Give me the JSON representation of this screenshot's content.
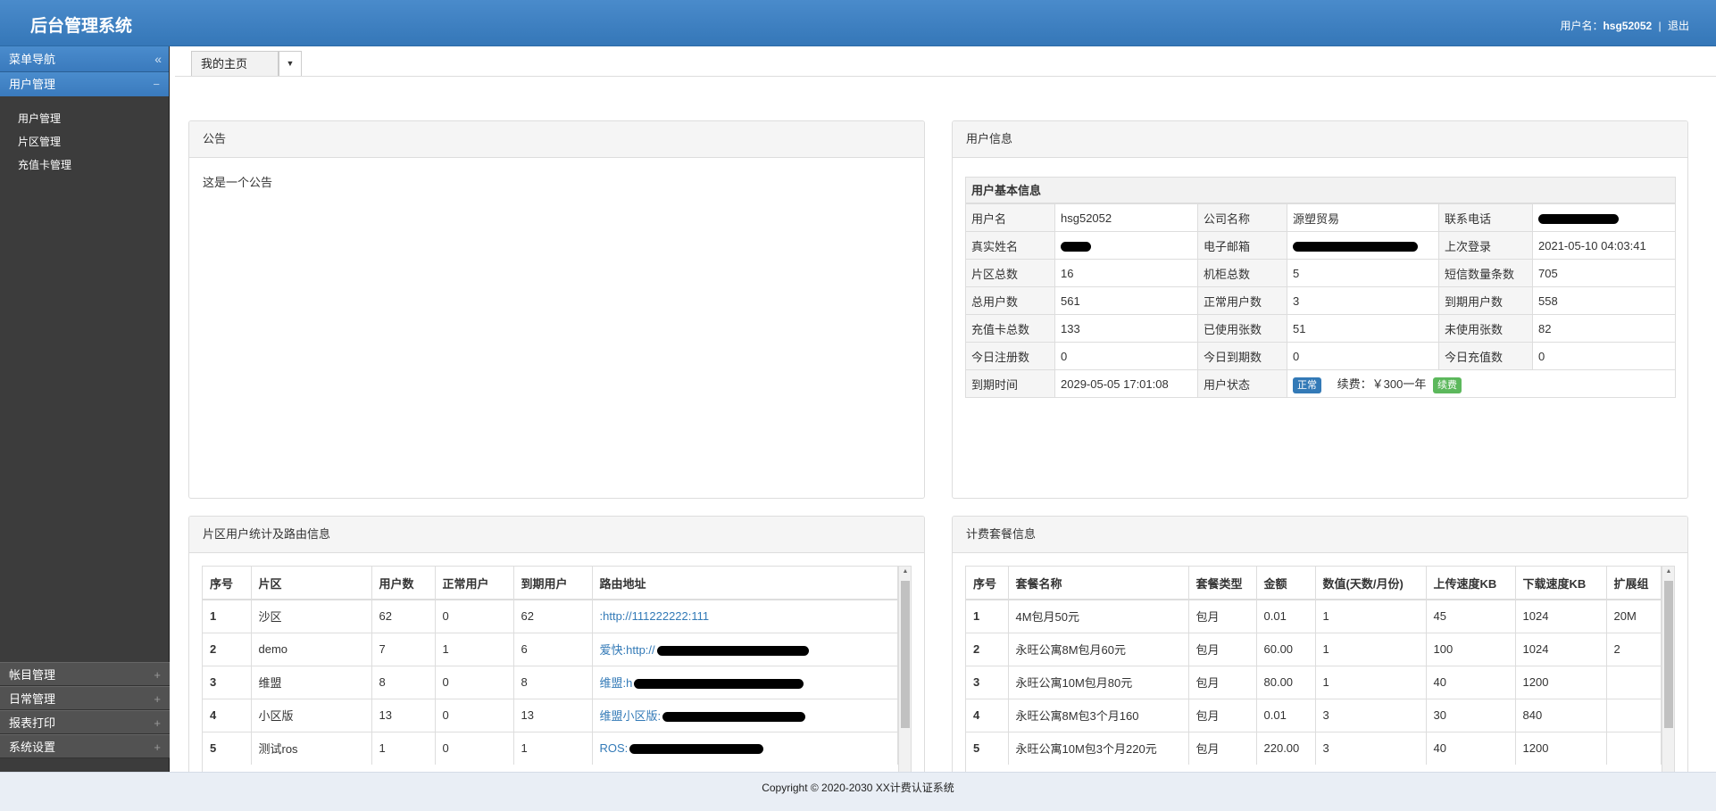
{
  "header": {
    "title": "后台管理系统",
    "user_label": "用户名：",
    "username": "hsg52052",
    "separator": "|",
    "logout": "退出"
  },
  "sidebar": {
    "nav_title": "菜单导航",
    "collapse_glyph": "«",
    "active_group": {
      "label": "用户管理",
      "toggle": "−"
    },
    "items": [
      {
        "label": "用户管理"
      },
      {
        "label": "片区管理"
      },
      {
        "label": "充值卡管理"
      }
    ],
    "groups": [
      {
        "label": "帐目管理",
        "toggle": "+"
      },
      {
        "label": "日常管理",
        "toggle": "+"
      },
      {
        "label": "报表打印",
        "toggle": "+"
      },
      {
        "label": "系统设置",
        "toggle": "+"
      }
    ]
  },
  "tabs": {
    "active": "我的主页",
    "dropdown_glyph": "▼"
  },
  "notice": {
    "title": "公告",
    "content": "这是一个公告"
  },
  "userinfo": {
    "title": "用户信息",
    "subtitle": "用户基本信息",
    "rows": [
      [
        {
          "l": "用户名",
          "v": "hsg52052"
        },
        {
          "l": "公司名称",
          "v": "源塑贸易"
        },
        {
          "l": "联系电话",
          "v": ""
        }
      ],
      [
        {
          "l": "真实姓名",
          "v": ""
        },
        {
          "l": "电子邮箱",
          "v": ""
        },
        {
          "l": "上次登录",
          "v": "2021-05-10 04:03:41"
        }
      ],
      [
        {
          "l": "片区总数",
          "v": "16"
        },
        {
          "l": "机柜总数",
          "v": "5"
        },
        {
          "l": "短信数量条数",
          "v": "705"
        }
      ],
      [
        {
          "l": "总用户数",
          "v": "561"
        },
        {
          "l": "正常用户数",
          "v": "3"
        },
        {
          "l": "到期用户数",
          "v": "558"
        }
      ],
      [
        {
          "l": "充值卡总数",
          "v": "133"
        },
        {
          "l": "已使用张数",
          "v": "51"
        },
        {
          "l": "未使用张数",
          "v": "82"
        }
      ],
      [
        {
          "l": "今日注册数",
          "v": "0"
        },
        {
          "l": "今日到期数",
          "v": "0"
        },
        {
          "l": "今日充值数",
          "v": "0"
        }
      ]
    ],
    "expire_label": "到期时间",
    "expire_value": "2029-05-05 17:01:08",
    "status_label": "用户状态",
    "status_badge": "正常",
    "renew_text": "续费：￥300一年",
    "renew_button": "续费",
    "colors": {
      "status": "#337ab7",
      "renew": "#5cb85c"
    }
  },
  "areas": {
    "title": "片区用户统计及路由信息",
    "columns": [
      "序号",
      "片区",
      "用户数",
      "正常用户",
      "到期用户",
      "路由地址"
    ],
    "rows": [
      {
        "id": "1",
        "area": "沙区",
        "users": "62",
        "normal": "0",
        "expired": "62",
        "route": ":http://111222222:111"
      },
      {
        "id": "2",
        "area": "demo",
        "users": "7",
        "normal": "1",
        "expired": "6",
        "route": "爱快:http://"
      },
      {
        "id": "3",
        "area": "维盟",
        "users": "8",
        "normal": "0",
        "expired": "8",
        "route": "维盟:h"
      },
      {
        "id": "4",
        "area": "小区版",
        "users": "13",
        "normal": "0",
        "expired": "13",
        "route": "维盟小区版:"
      },
      {
        "id": "5",
        "area": "测试ros",
        "users": "1",
        "normal": "0",
        "expired": "1",
        "route": "ROS:"
      }
    ]
  },
  "plans": {
    "title": "计费套餐信息",
    "columns": [
      "序号",
      "套餐名称",
      "套餐类型",
      "金额",
      "数值(天数/月份)",
      "上传速度KB",
      "下载速度KB",
      "扩展组"
    ],
    "rows": [
      {
        "id": "1",
        "name": "4M包月50元",
        "type": "包月",
        "amount": "0.01",
        "value": "1",
        "up": "45",
        "down": "1024",
        "ext": "20M"
      },
      {
        "id": "2",
        "name": "永旺公寓8M包月60元",
        "type": "包月",
        "amount": "60.00",
        "value": "1",
        "up": "100",
        "down": "1024",
        "ext": "2"
      },
      {
        "id": "3",
        "name": "永旺公寓10M包月80元",
        "type": "包月",
        "amount": "80.00",
        "value": "1",
        "up": "40",
        "down": "1200",
        "ext": ""
      },
      {
        "id": "4",
        "name": "永旺公寓8M包3个月160",
        "type": "包月",
        "amount": "0.01",
        "value": "3",
        "up": "30",
        "down": "840",
        "ext": ""
      },
      {
        "id": "5",
        "name": "永旺公寓10M包3个月220元",
        "type": "包月",
        "amount": "220.00",
        "value": "3",
        "up": "40",
        "down": "1200",
        "ext": ""
      }
    ]
  },
  "footer": {
    "copyright": "Copyright © 2020-2030 XX计费认证系统"
  }
}
